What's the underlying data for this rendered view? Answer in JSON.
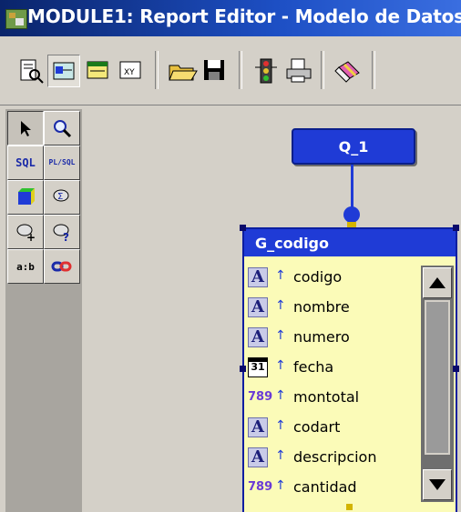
{
  "window": {
    "title": "MODULE1: Report Editor - Modelo de Datos"
  },
  "toolbar": {
    "buttons": [
      {
        "icon": "report-wizard-icon"
      },
      {
        "icon": "data-model-view-icon"
      },
      {
        "icon": "layout-view-icon"
      },
      {
        "icon": "runtime-previewer-icon"
      },
      {
        "icon": "open-folder-icon"
      },
      {
        "icon": "save-disk-icon"
      },
      {
        "icon": "run-traffic-light-icon"
      },
      {
        "icon": "print-icon"
      },
      {
        "icon": "eraser-icon"
      }
    ]
  },
  "palette": {
    "tools": [
      {
        "icon": "select-arrow-icon"
      },
      {
        "icon": "magnify-icon"
      },
      {
        "label": "SQL",
        "icon": "sql-query-icon"
      },
      {
        "label": "PL/SQL",
        "icon": "plsql-icon"
      },
      {
        "icon": "cube-icon"
      },
      {
        "icon": "summary-column-icon"
      },
      {
        "icon": "formula-column-icon"
      },
      {
        "icon": "placeholder-column-icon"
      },
      {
        "label": "a:b",
        "icon": "cross-product-icon"
      },
      {
        "icon": "data-link-icon"
      }
    ]
  },
  "canvas": {
    "query": {
      "name": "Q_1"
    },
    "group": {
      "name": "G_codigo",
      "columns": [
        {
          "name": "codigo",
          "type_icon": "char-type-icon"
        },
        {
          "name": "nombre",
          "type_icon": "char-type-icon"
        },
        {
          "name": "numero",
          "type_icon": "char-type-icon"
        },
        {
          "name": "fecha",
          "type_icon": "date-type-icon",
          "date_glyph": "31"
        },
        {
          "name": "montotal",
          "type_icon": "number-type-icon",
          "num_glyph": "789"
        },
        {
          "name": "codart",
          "type_icon": "char-type-icon"
        },
        {
          "name": "descripcion",
          "type_icon": "char-type-icon"
        },
        {
          "name": "cantidad",
          "type_icon": "number-type-icon",
          "num_glyph": "789"
        }
      ],
      "char_glyph": "A",
      "arrow_glyph": "↑"
    }
  },
  "colors": {
    "title_bar": "#0a246a",
    "node_blue": "#1f3bd6",
    "group_fill": "#fbfbb8",
    "chrome": "#d4d0c8"
  }
}
